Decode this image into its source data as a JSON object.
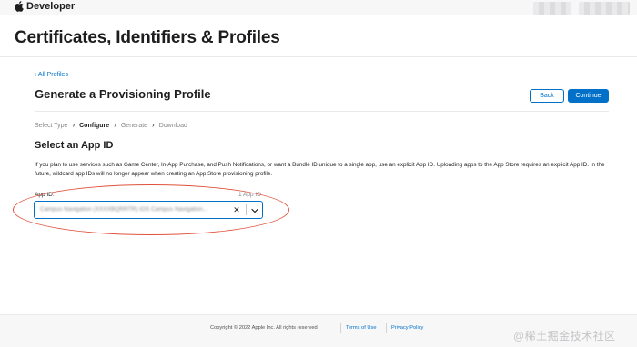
{
  "topbar": {
    "brand_label": "Developer"
  },
  "header": {
    "title": "Certificates, Identifiers & Profiles"
  },
  "breadcrumb": {
    "back_label": "‹ All Profiles"
  },
  "form": {
    "title": "Generate a Provisioning Profile",
    "back_button": "Back",
    "continue_button": "Continue"
  },
  "steps": [
    {
      "label": "Select Type",
      "active": false
    },
    {
      "label": "Configure",
      "active": true
    },
    {
      "label": "Generate",
      "active": false
    },
    {
      "label": "Download",
      "active": false
    }
  ],
  "section": {
    "heading": "Select an App ID",
    "description": "If you plan to use services such as Game Center, In-App Purchase, and Push Notifications, or want a Bundle ID unique to a single app, use an explicit App ID. Uploading apps to the App Store requires an explicit App ID. In the future, wildcard app IDs will no longer appear when creating an App Store provisioning profile."
  },
  "appid": {
    "label": "App ID:",
    "count": "1 App ID",
    "selected_value": "Campus Navigation (XXXXBQRRTR) iOS Campus Navigation..."
  },
  "footer": {
    "copyright": "Copyright © 2022 Apple Inc. All rights reserved.",
    "terms": "Terms of Use",
    "privacy": "Privacy Policy",
    "watermark": "@稀土掘金技术社区"
  },
  "colors": {
    "accent": "#0070c9",
    "highlight": "#e0523c",
    "text": "#1d1d1f",
    "muted": "#86868b"
  },
  "icons": {
    "brand": "apple-logo-icon",
    "clear": "close-icon",
    "dropdown": "chevron-down-icon",
    "step_separator": "chevron-right-icon"
  }
}
